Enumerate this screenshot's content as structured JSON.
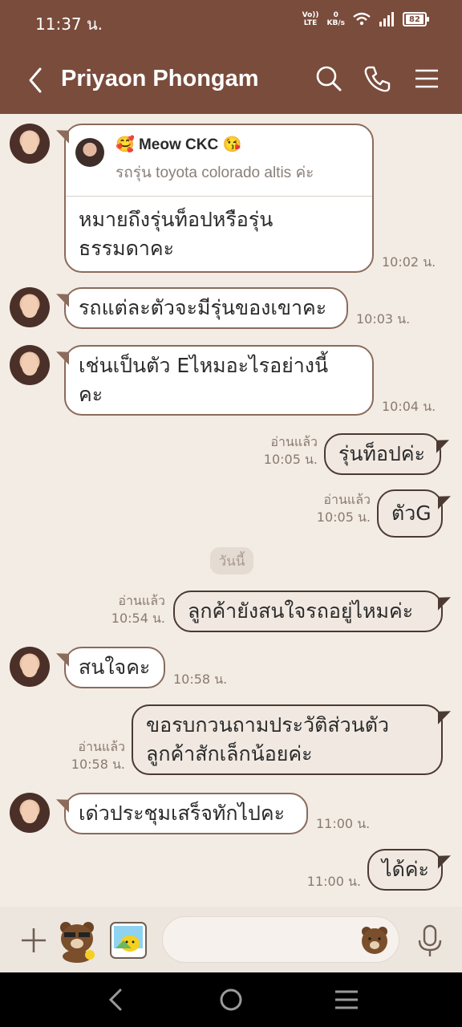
{
  "status_bar": {
    "time": "11:37 น.",
    "volte": "Vo))",
    "lte": "LTE",
    "speed_value": "0",
    "speed_unit": "KB/s",
    "battery": "82"
  },
  "header": {
    "title": "Priyaon Phongam"
  },
  "quote_message": {
    "name": "Meow CKC",
    "quoted_text": "รถรุ่น toyota colorado altis ค่ะ",
    "line1": "หมายถึงรุ่นท็อปหรือรุ่น",
    "line2": "ธรรมดาคะ",
    "time": "10:02 น."
  },
  "messages": [
    {
      "text": "รถแต่ละตัวจะมีรุ่นของเขาคะ",
      "time": "10:03 น."
    },
    {
      "line1": "เช่นเป็นตัว Eไหมอะไรอย่างนี้",
      "line2": "คะ",
      "time": "10:04 น."
    },
    {
      "text": "รุ่นท็อปค่ะ",
      "read": "อ่านแล้ว",
      "time": "10:05 น."
    },
    {
      "text": "ตัวG",
      "read": "อ่านแล้ว",
      "time": "10:05 น."
    },
    {
      "text": "ลูกค้ายังสนใจรถอยู่ไหมค่ะ",
      "read": "อ่านแล้ว",
      "time": "10:54 น."
    },
    {
      "text": "สนใจคะ",
      "time": "10:58 น."
    },
    {
      "line1": "ขอรบกวนถามประวัติส่วนตัว",
      "line2": "ลูกค้าสักเล็กน้อยค่ะ",
      "read": "อ่านแล้ว",
      "time": "10:58 น."
    },
    {
      "text": "เด่วประชุมเสร็จทักไปคะ",
      "time": "11:00 น."
    },
    {
      "text": "ได้ค่ะ",
      "time": "11:00 น."
    }
  ],
  "date_divider": "วันนี้",
  "icons": {
    "back": "chevron-left-icon",
    "search": "search-icon",
    "call": "phone-icon",
    "menu": "hamburger-icon",
    "plus": "plus-icon",
    "sticker1": "brown-bear-sticker-icon",
    "sticker2": "photo-sticker-icon",
    "emoji": "bear-emoji-icon",
    "mic": "microphone-icon"
  },
  "colors": {
    "header_bg": "#7a4c3c",
    "chat_bg": "#f3ece4",
    "bubble_border": "#8a6b5c",
    "outgoing_border": "#4a3a33"
  }
}
